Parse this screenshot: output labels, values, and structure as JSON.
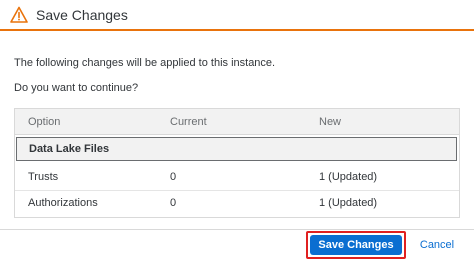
{
  "dialog": {
    "title": "Save Changes",
    "icon": "warning-triangle-icon",
    "accent_color": "#e9730c"
  },
  "messages": {
    "line1": "The following changes will be applied to this instance.",
    "line2": "Do you want to continue?"
  },
  "table": {
    "columns": [
      "Option",
      "Current",
      "New"
    ],
    "group": "Data Lake Files",
    "rows": [
      {
        "option": "Trusts",
        "current": "0",
        "new": "1 (Updated)"
      },
      {
        "option": "Authorizations",
        "current": "0",
        "new": "1 (Updated)"
      }
    ]
  },
  "footer": {
    "save_label": "Save Changes",
    "cancel_label": "Cancel",
    "primary_color": "#0a6ed1",
    "highlight_color": "#e02020"
  }
}
